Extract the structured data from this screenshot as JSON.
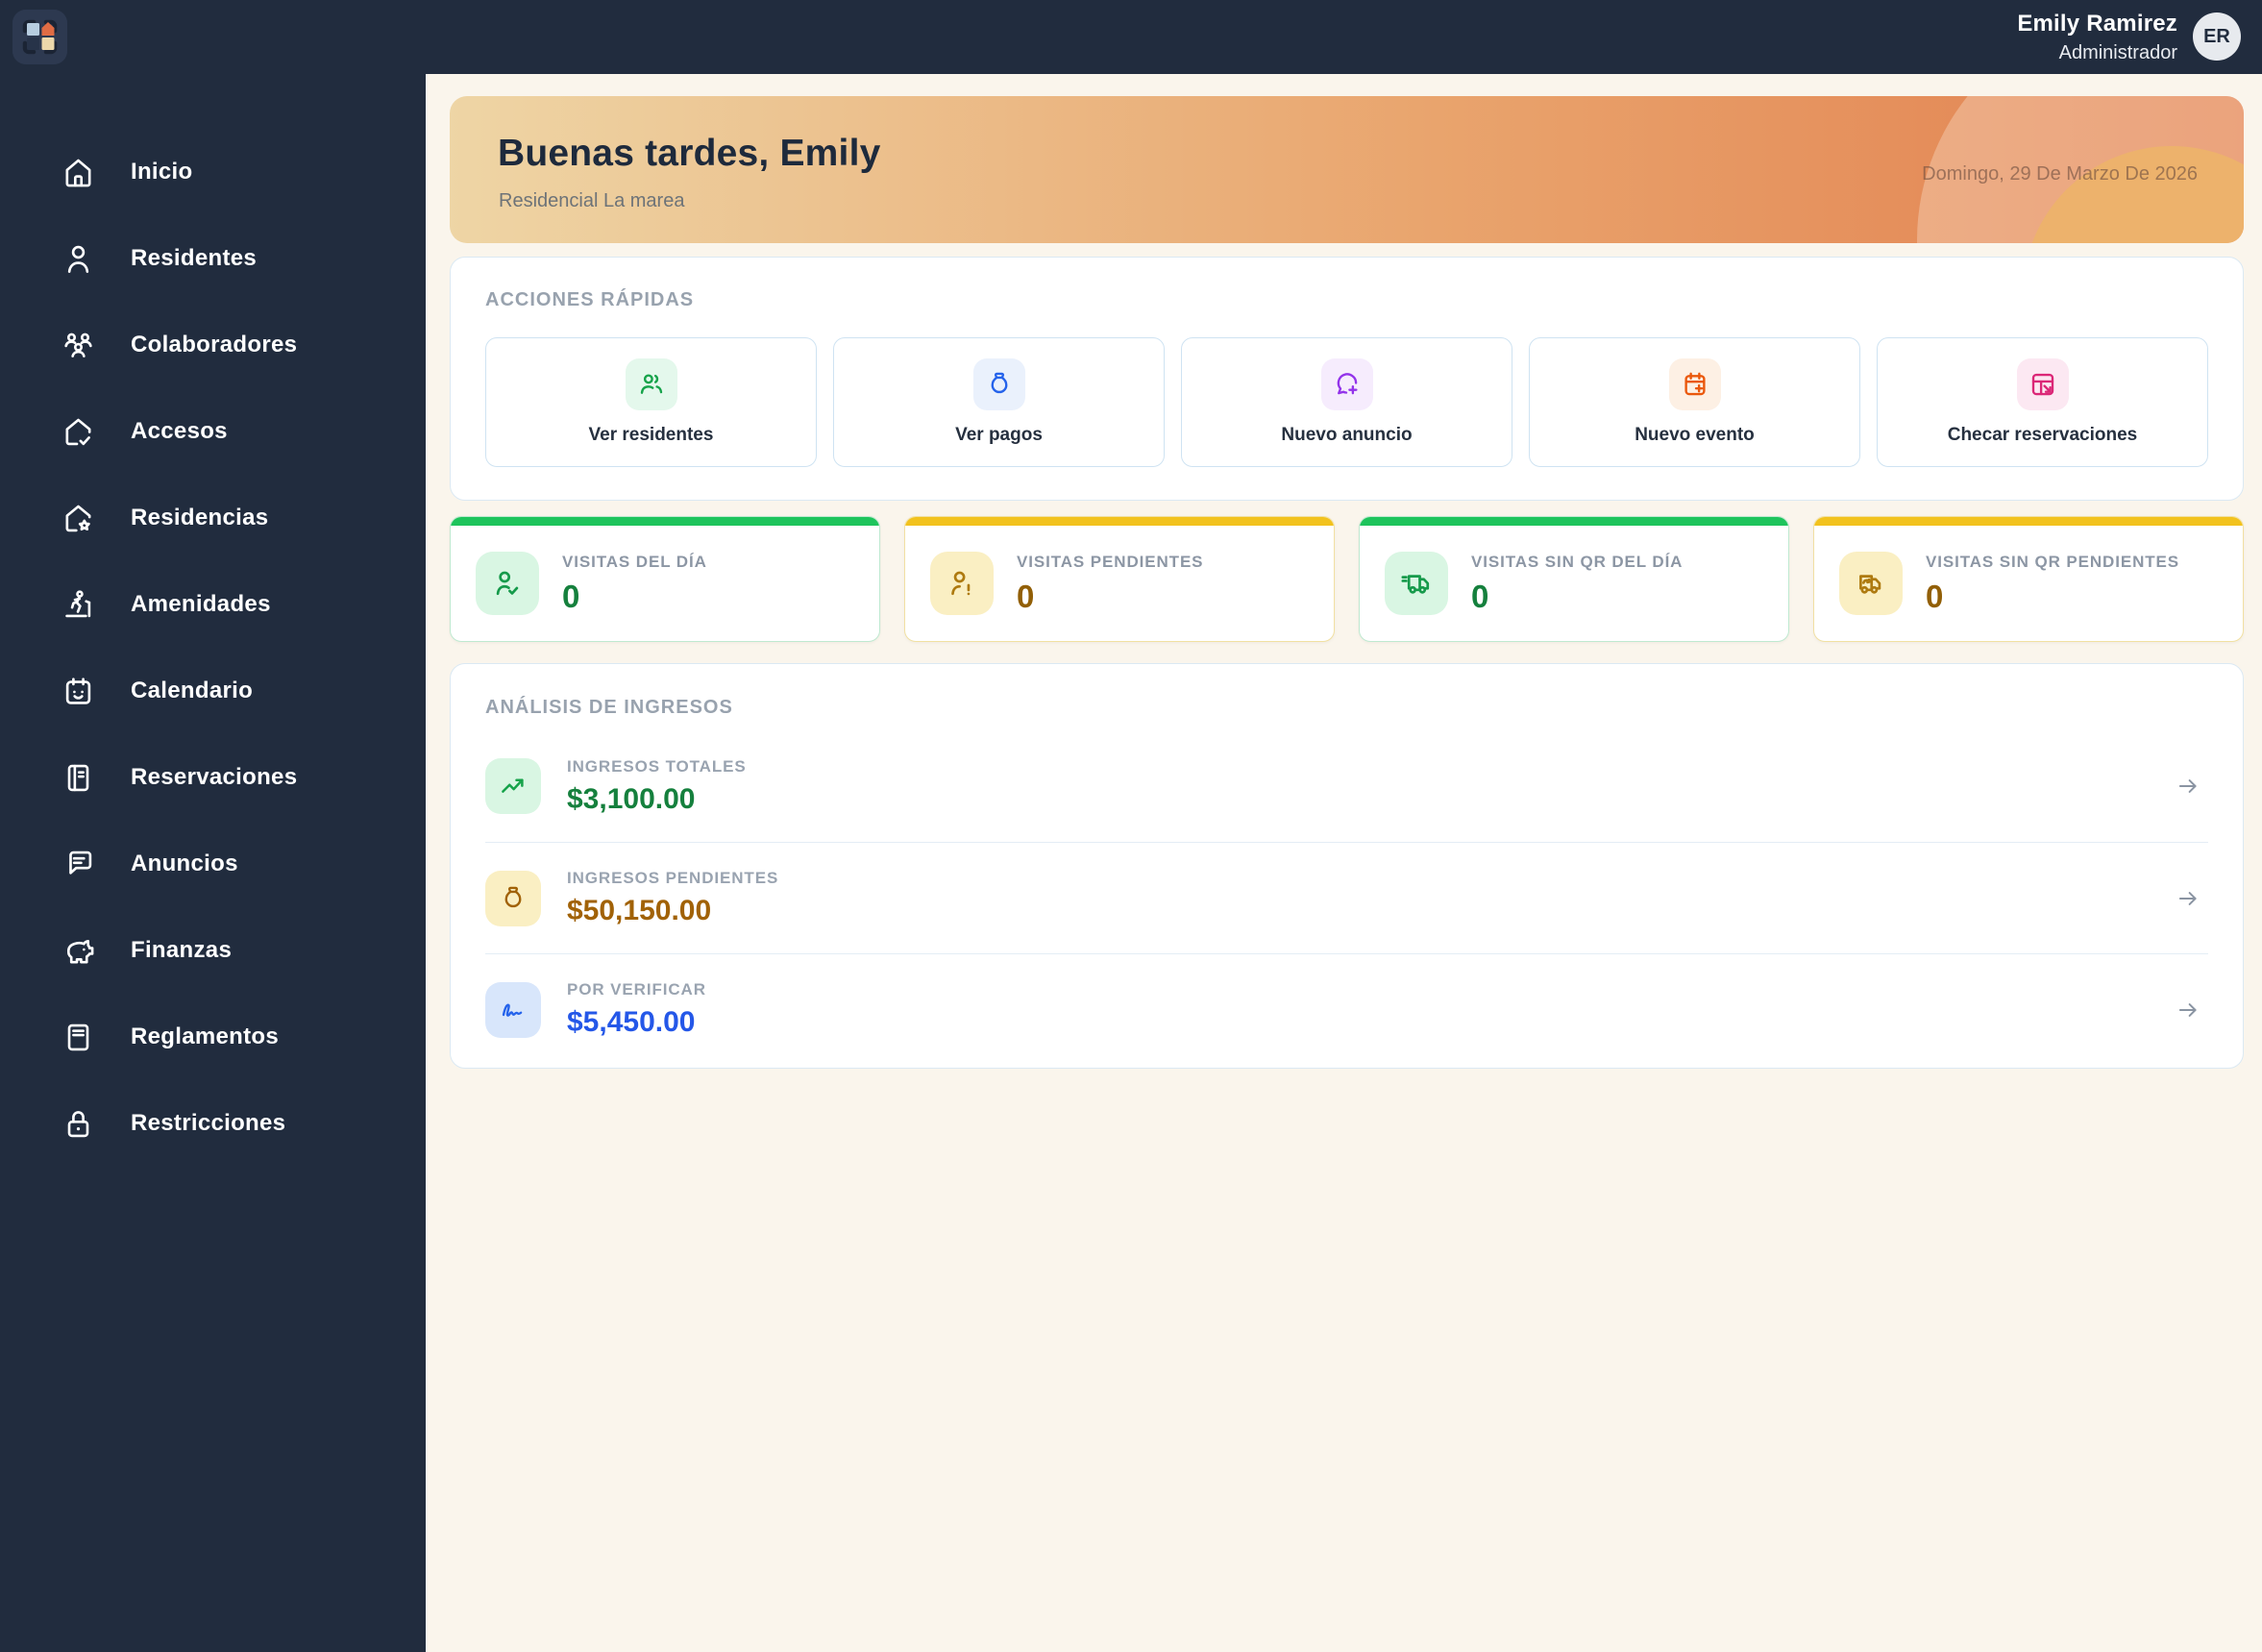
{
  "topbar": {
    "user_name": "Emily Ramirez",
    "user_role": "Administrador",
    "avatar_initials": "ER"
  },
  "sidebar": {
    "items": [
      {
        "label": "Inicio",
        "icon": "home-icon"
      },
      {
        "label": "Residentes",
        "icon": "person-icon"
      },
      {
        "label": "Colaboradores",
        "icon": "people-group-icon"
      },
      {
        "label": "Accesos",
        "icon": "house-check-icon"
      },
      {
        "label": "Residencias",
        "icon": "house-star-icon"
      },
      {
        "label": "Amenidades",
        "icon": "treadmill-runner-icon"
      },
      {
        "label": "Calendario",
        "icon": "calendar-smile-icon"
      },
      {
        "label": "Reservaciones",
        "icon": "notebook-icon"
      },
      {
        "label": "Anuncios",
        "icon": "message-lines-icon"
      },
      {
        "label": "Finanzas",
        "icon": "piggy-bank-icon"
      },
      {
        "label": "Reglamentos",
        "icon": "book-icon"
      },
      {
        "label": "Restricciones",
        "icon": "lock-icon"
      }
    ]
  },
  "banner": {
    "greeting": "Buenas tardes, Emily",
    "residence": "Residencial La marea",
    "date": "Domingo, 29 De Marzo De 2026"
  },
  "quick_actions": {
    "title": "ACCIONES RÁPIDAS",
    "actions": [
      {
        "label": "Ver residentes",
        "icon": "people-group-icon",
        "accent": "#16a34a",
        "bg": "#e4f8ec"
      },
      {
        "label": "Ver pagos",
        "icon": "money-bag-icon",
        "accent": "#2563eb",
        "bg": "#eaf1fc"
      },
      {
        "label": "Nuevo anuncio",
        "icon": "message-plus-icon",
        "accent": "#9333ea",
        "bg": "#f6ecfd"
      },
      {
        "label": "Nuevo evento",
        "icon": "calendar-plus-icon",
        "accent": "#ea580c",
        "bg": "#fdf0e4"
      },
      {
        "label": "Checar reservaciones",
        "icon": "table-arrow-icon",
        "accent": "#db2777",
        "bg": "#fce8f2"
      }
    ]
  },
  "stats": {
    "cards": [
      {
        "label": "VISITAS DEL DÍA",
        "value": "0",
        "icon": "person-check-icon",
        "theme": "green"
      },
      {
        "label": "VISITAS PENDIENTES",
        "value": "0",
        "icon": "person-alert-icon",
        "theme": "yellow"
      },
      {
        "label": "VISITAS SIN QR DEL DÍA",
        "value": "0",
        "icon": "truck-icon",
        "theme": "green"
      },
      {
        "label": "VISITAS SIN QR PENDIENTES",
        "value": "0",
        "icon": "truck-return-icon",
        "theme": "yellow"
      }
    ]
  },
  "income": {
    "title": "ANÁLISIS DE INGRESOS",
    "rows": [
      {
        "label": "INGRESOS TOTALES",
        "value": "$3,100.00",
        "icon": "trending-up-icon",
        "theme": "green"
      },
      {
        "label": "INGRESOS PENDIENTES",
        "value": "$50,150.00",
        "icon": "money-bag-icon",
        "theme": "yellow"
      },
      {
        "label": "POR VERIFICAR",
        "value": "$5,450.00",
        "icon": "signature-icon",
        "theme": "blue"
      }
    ]
  },
  "colors": {
    "sidebar_bg": "#212c3e",
    "content_bg": "#faf5ec",
    "banner_gradient_start": "#eed5a5",
    "banner_gradient_end": "#e2804f",
    "green_accent": "#1ec45c",
    "green_dark": "#15803d",
    "yellow_accent": "#f2c21d",
    "yellow_dark": "#a16207",
    "blue_accent": "#2563eb",
    "purple_accent": "#9333ea",
    "orange_accent": "#ea580c",
    "pink_accent": "#db2777"
  }
}
